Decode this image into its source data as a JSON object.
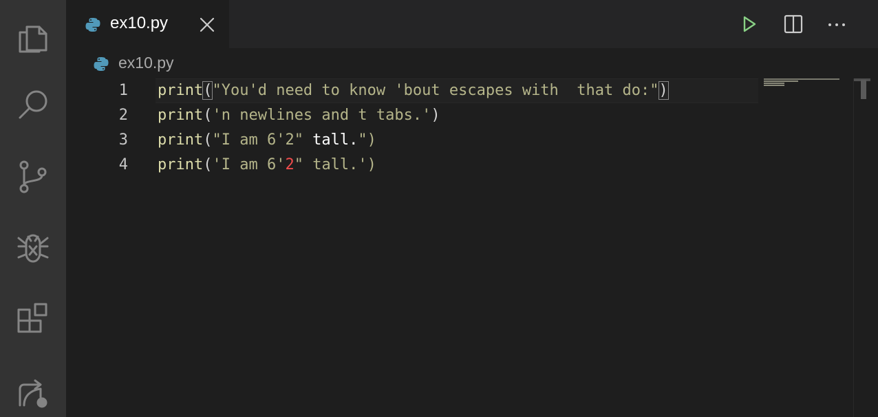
{
  "activity_bar": {
    "items": [
      {
        "name": "explorer",
        "icon": "files-icon"
      },
      {
        "name": "search",
        "icon": "search-icon"
      },
      {
        "name": "source-control",
        "icon": "source-control-icon"
      },
      {
        "name": "run-and-debug",
        "icon": "debug-icon"
      },
      {
        "name": "extensions",
        "icon": "extensions-icon"
      },
      {
        "name": "remote-explorer",
        "icon": "remote-icon"
      }
    ]
  },
  "tabs": [
    {
      "label": "ex10.py",
      "active": true,
      "icon": "python-icon"
    }
  ],
  "toolbar": {
    "run_icon": "play-icon",
    "split_icon": "split-editor-icon",
    "more_icon": "more-actions-icon"
  },
  "breadcrumb": {
    "file": "ex10.py"
  },
  "editor": {
    "lines": [
      {
        "number": "1",
        "segments": [
          {
            "t": "print",
            "c": "fn"
          },
          {
            "t": "(",
            "c": "punc bm"
          },
          {
            "t": "\"You'd need to know 'bout escapes with  that do:\"",
            "c": "strd"
          },
          {
            "t": ")",
            "c": "punc bm"
          }
        ]
      },
      {
        "number": "2",
        "segments": [
          {
            "t": "print",
            "c": "fn"
          },
          {
            "t": "(",
            "c": "punc"
          },
          {
            "t": "'n newlines and t tabs.'",
            "c": "strd"
          },
          {
            "t": ")",
            "c": "punc"
          }
        ]
      },
      {
        "number": "3",
        "segments": [
          {
            "t": "print",
            "c": "fn"
          },
          {
            "t": "(",
            "c": "punc"
          },
          {
            "t": "\"I am 6'2\"",
            "c": "strd"
          },
          {
            "t": " tall.",
            "c": "white"
          },
          {
            "t": "\")",
            "c": "strd"
          }
        ]
      },
      {
        "number": "4",
        "segments": [
          {
            "t": "print",
            "c": "fn"
          },
          {
            "t": "(",
            "c": "punc"
          },
          {
            "t": "'I am 6'",
            "c": "strd"
          },
          {
            "t": "2",
            "c": "num-red"
          },
          {
            "t": "\" tall.')",
            "c": "strd"
          }
        ]
      }
    ]
  },
  "colors": {
    "activity_bar": "#333333",
    "editor_bg": "#1e1e1e",
    "function": "#dcdcaa",
    "string": "#b5b58a",
    "run_button": "#89d185",
    "python_blue": "#3776ab",
    "python_yellow": "#519aba"
  }
}
